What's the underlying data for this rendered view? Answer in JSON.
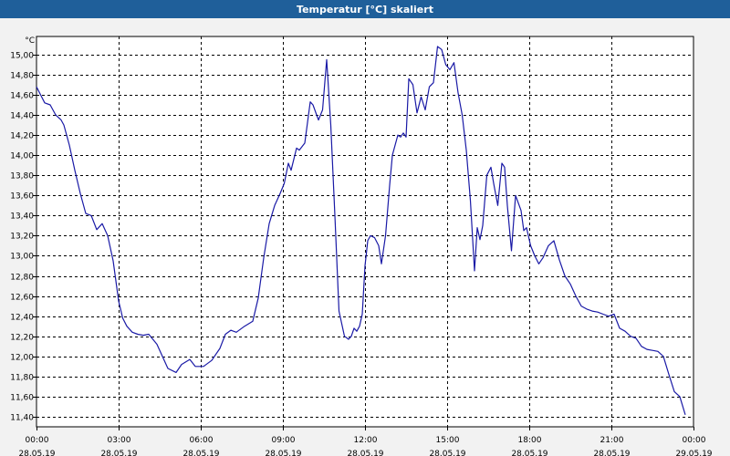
{
  "window": {
    "title": "Temperatur [°C] skaliert"
  },
  "chart_data": {
    "type": "line",
    "title": "Temperatur [°C] skaliert",
    "ylabel": "°C",
    "xlabel": "",
    "ylim": [
      11.3,
      15.18
    ],
    "grid": true,
    "line_color": "#1a1aa6",
    "yticks": [
      "11,40",
      "11,60",
      "11,80",
      "12,00",
      "12,20",
      "12,40",
      "12,60",
      "12,80",
      "13,00",
      "13,20",
      "13,40",
      "13,60",
      "13,80",
      "14,00",
      "14,20",
      "14,40",
      "14,60",
      "14,80",
      "15,00"
    ],
    "xticks": [
      {
        "time": "00:00",
        "date": "28.05.19"
      },
      {
        "time": "03:00",
        "date": "28.05.19"
      },
      {
        "time": "06:00",
        "date": "28.05.19"
      },
      {
        "time": "09:00",
        "date": "28.05.19"
      },
      {
        "time": "12:00",
        "date": "28.05.19"
      },
      {
        "time": "15:00",
        "date": "28.05.19"
      },
      {
        "time": "18:00",
        "date": "28.05.19"
      },
      {
        "time": "21:00",
        "date": "28.05.19"
      },
      {
        "time": "00:00",
        "date": "29.05.19"
      }
    ],
    "series": [
      {
        "x_hours": [
          0,
          0.15,
          0.3,
          0.5,
          0.7,
          0.9,
          1.0,
          1.2,
          1.4,
          1.6,
          1.8,
          2.0,
          2.2,
          2.4,
          2.6,
          2.8,
          3.0,
          3.15,
          3.3,
          3.5,
          3.7,
          3.9,
          4.1,
          4.4,
          4.6,
          4.8,
          5.1,
          5.3,
          5.6,
          5.8,
          6.1,
          6.4,
          6.7,
          6.9,
          7.1,
          7.3,
          7.6,
          7.9,
          8.1,
          8.3,
          8.5,
          8.7,
          8.9,
          9.05,
          9.2,
          9.3,
          9.5,
          9.6,
          9.8,
          10.0,
          10.1,
          10.3,
          10.45,
          10.6,
          10.75,
          10.9,
          11.05,
          11.25,
          11.4,
          11.5,
          11.6,
          11.7,
          11.8,
          11.9,
          12.0,
          12.1,
          12.2,
          12.35,
          12.5,
          12.6,
          12.75,
          12.9,
          13.0,
          13.2,
          13.3,
          13.4,
          13.5,
          13.6,
          13.75,
          13.9,
          14.05,
          14.2,
          14.35,
          14.5,
          14.65,
          14.8,
          14.95,
          15.1,
          15.25,
          15.4,
          15.55,
          15.7,
          15.85,
          16.0,
          16.1,
          16.2,
          16.3,
          16.45,
          16.6,
          16.7,
          16.85,
          17.0,
          17.1,
          17.2,
          17.35,
          17.5,
          17.7,
          17.8,
          17.9,
          18.05,
          18.2,
          18.35,
          18.5,
          18.7,
          18.9,
          19.1,
          19.3,
          19.5,
          19.7,
          19.9,
          20.1,
          20.3,
          20.5,
          20.7,
          20.9,
          21.1,
          21.3,
          21.5,
          21.7,
          21.9,
          22.1,
          22.3,
          22.5,
          22.7,
          22.9,
          23.1,
          23.3,
          23.5,
          23.7,
          23.85,
          23.95
        ],
        "values": [
          14.68,
          14.6,
          14.52,
          14.5,
          14.4,
          14.35,
          14.3,
          14.1,
          13.85,
          13.62,
          13.42,
          13.4,
          13.26,
          13.32,
          13.2,
          12.95,
          12.55,
          12.38,
          12.3,
          12.24,
          12.22,
          12.21,
          12.22,
          12.12,
          12.0,
          11.88,
          11.84,
          11.92,
          11.97,
          11.9,
          11.9,
          11.96,
          12.08,
          12.22,
          12.26,
          12.24,
          12.3,
          12.35,
          12.58,
          12.98,
          13.32,
          13.5,
          13.62,
          13.72,
          13.92,
          13.85,
          14.07,
          14.05,
          14.12,
          14.53,
          14.5,
          14.35,
          14.45,
          14.95,
          14.3,
          13.4,
          12.45,
          12.2,
          12.17,
          12.2,
          12.28,
          12.25,
          12.3,
          12.42,
          12.9,
          13.15,
          13.2,
          13.18,
          13.1,
          12.92,
          13.2,
          13.7,
          14.0,
          14.2,
          14.18,
          14.22,
          14.18,
          14.76,
          14.7,
          14.42,
          14.58,
          14.45,
          14.68,
          14.72,
          15.08,
          15.05,
          14.9,
          14.85,
          14.92,
          14.62,
          14.4,
          14.05,
          13.55,
          12.85,
          13.28,
          13.16,
          13.3,
          13.8,
          13.88,
          13.72,
          13.5,
          13.92,
          13.88,
          13.5,
          13.05,
          13.6,
          13.45,
          13.25,
          13.28,
          13.1,
          13.0,
          12.92,
          12.98,
          13.1,
          13.15,
          12.96,
          12.8,
          12.72,
          12.6,
          12.5,
          12.47,
          12.45,
          12.44,
          12.42,
          12.4,
          12.42,
          12.28,
          12.25,
          12.2,
          12.18,
          12.1,
          12.07,
          12.06,
          12.05,
          12.0,
          11.82,
          11.65,
          11.6,
          11.42
        ]
      }
    ]
  }
}
